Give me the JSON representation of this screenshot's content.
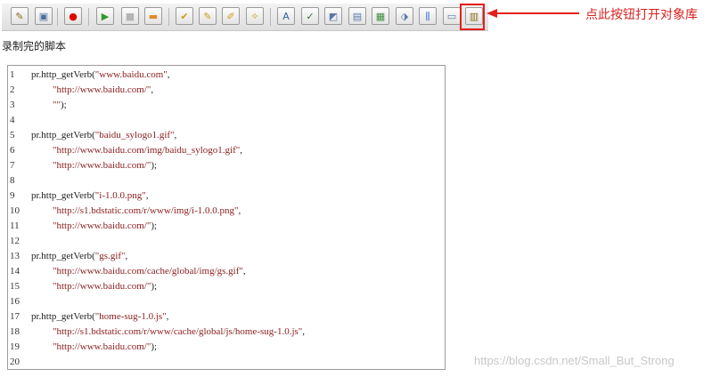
{
  "toolbar": {
    "buttons": [
      {
        "icon": "open-script-icon",
        "glyph": "✎",
        "color": "#8a6d1a"
      },
      {
        "icon": "save-icon",
        "glyph": "▣",
        "color": "#4a6d9a"
      },
      {
        "icon": "record-icon",
        "glyph": "●",
        "color": "#e00000"
      },
      {
        "icon": "play-icon",
        "glyph": "▶",
        "color": "#2f9a2f"
      },
      {
        "icon": "stop-icon",
        "glyph": "■",
        "color": "#b5b5b5"
      },
      {
        "icon": "step-icon",
        "glyph": "▬",
        "color": "#e08a2a"
      },
      {
        "icon": "edit-check-icon",
        "glyph": "✔",
        "color": "#c8a014"
      },
      {
        "icon": "edit-tag-icon",
        "glyph": "✎",
        "color": "#c8a014"
      },
      {
        "icon": "edit-pen-icon",
        "glyph": "✐",
        "color": "#c8a014"
      },
      {
        "icon": "edit-star-icon",
        "glyph": "✧",
        "color": "#c8a014"
      },
      {
        "icon": "text-insert-icon",
        "glyph": "A",
        "color": "#3b5f9a"
      },
      {
        "icon": "image-check-icon",
        "glyph": "✓",
        "color": "#3b6f3b"
      },
      {
        "icon": "checkpoint-icon",
        "glyph": "◩",
        "color": "#5a7aa8"
      },
      {
        "icon": "window-check-icon",
        "glyph": "▤",
        "color": "#5a7aa8"
      },
      {
        "icon": "table-check-icon",
        "glyph": "▦",
        "color": "#3b8f3b"
      },
      {
        "icon": "db-check-icon",
        "glyph": "⬗",
        "color": "#5a7aa8"
      },
      {
        "icon": "parameter-icon",
        "glyph": "⫼",
        "color": "#3b6fc8"
      },
      {
        "icon": "output-icon",
        "glyph": "▭",
        "color": "#5a7aa8"
      },
      {
        "icon": "object-repository-icon",
        "glyph": "▥",
        "color": "#8a6d1a"
      }
    ]
  },
  "annotation": {
    "text": "点此按钮打开对象库",
    "color": "#d9221f"
  },
  "section_title": "录制完的脚本",
  "code_lines": [
    {
      "n": "1",
      "indent": 0,
      "pre": "pr.http_getVerb(",
      "str": "\"www.baidu.com\"",
      "post": ","
    },
    {
      "n": "2",
      "indent": 1,
      "pre": "",
      "str": "\"http://www.baidu.com/\"",
      "post": ","
    },
    {
      "n": "3",
      "indent": 1,
      "pre": "",
      "str": "\"\"",
      "post": ");"
    },
    {
      "n": "4",
      "indent": 0,
      "pre": "",
      "str": "",
      "post": ""
    },
    {
      "n": "5",
      "indent": 0,
      "pre": "pr.http_getVerb(",
      "str": "\"baidu_sylogo1.gif\"",
      "post": ","
    },
    {
      "n": "6",
      "indent": 1,
      "pre": "",
      "str": "\"http://www.baidu.com/img/baidu_sylogo1.gif\"",
      "post": ","
    },
    {
      "n": "7",
      "indent": 1,
      "pre": "",
      "str": "\"http://www.baidu.com/\"",
      "post": ");"
    },
    {
      "n": "8",
      "indent": 0,
      "pre": "",
      "str": "",
      "post": ""
    },
    {
      "n": "9",
      "indent": 0,
      "pre": "pr.http_getVerb(",
      "str": "\"i-1.0.0.png\"",
      "post": ","
    },
    {
      "n": "10",
      "indent": 1,
      "pre": "",
      "str": "\"http://s1.bdstatic.com/r/www/img/i-1.0.0.png\"",
      "post": ","
    },
    {
      "n": "11",
      "indent": 1,
      "pre": "",
      "str": "\"http://www.baidu.com/\"",
      "post": ");"
    },
    {
      "n": "12",
      "indent": 0,
      "pre": "",
      "str": "",
      "post": ""
    },
    {
      "n": "13",
      "indent": 0,
      "pre": "pr.http_getVerb(",
      "str": "\"gs.gif\"",
      "post": ","
    },
    {
      "n": "14",
      "indent": 1,
      "pre": "",
      "str": "\"http://www.baidu.com/cache/global/img/gs.gif\"",
      "post": ","
    },
    {
      "n": "15",
      "indent": 1,
      "pre": "",
      "str": "\"http://www.baidu.com/\"",
      "post": ");"
    },
    {
      "n": "16",
      "indent": 0,
      "pre": "",
      "str": "",
      "post": ""
    },
    {
      "n": "17",
      "indent": 0,
      "pre": "pr.http_getVerb(",
      "str": "\"home-sug-1.0.js\"",
      "post": ","
    },
    {
      "n": "18",
      "indent": 1,
      "pre": "",
      "str": "\"http://s1.bdstatic.com/r/www/cache/global/js/home-sug-1.0.js\"",
      "post": ","
    },
    {
      "n": "19",
      "indent": 1,
      "pre": "",
      "str": "\"http://www.baidu.com/\"",
      "post": ");"
    },
    {
      "n": "20",
      "indent": 0,
      "pre": "",
      "str": "",
      "post": ""
    }
  ],
  "watermark": "https://blog.csdn.net/Small_But_Strong"
}
